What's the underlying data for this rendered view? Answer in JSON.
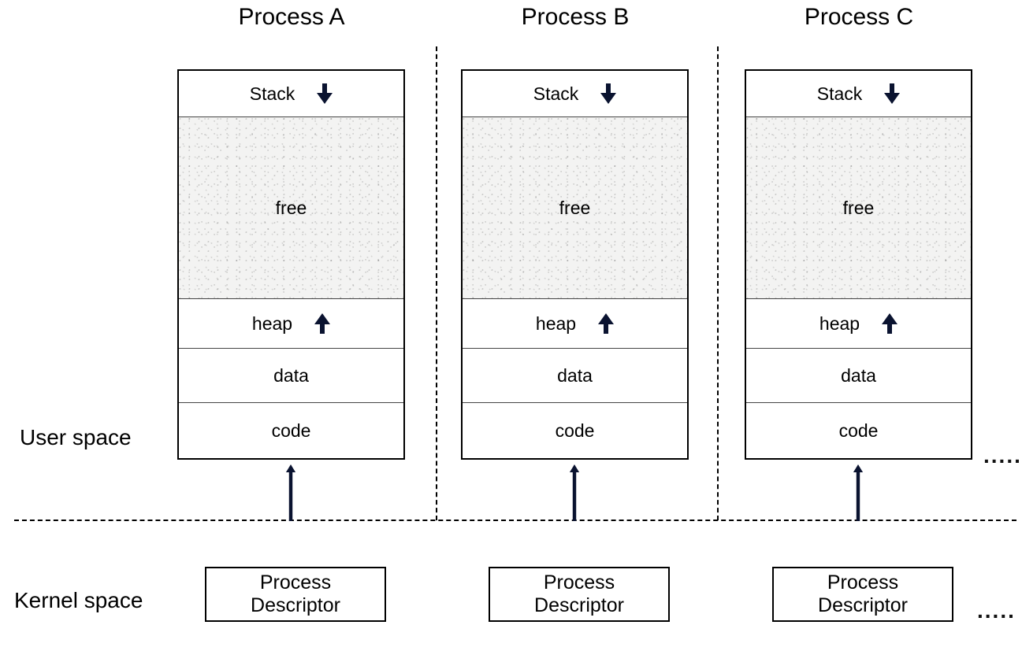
{
  "titles": {
    "A": "Process A",
    "B": "Process B",
    "C": "Process C"
  },
  "segments": {
    "stack": "Stack",
    "free": "free",
    "heap": "heap",
    "data": "data",
    "code": "code"
  },
  "space": {
    "user": "User space",
    "kernel": "Kernel space"
  },
  "pd": {
    "line1": "Process",
    "line2": "Descriptor"
  },
  "ellipsis": "....."
}
